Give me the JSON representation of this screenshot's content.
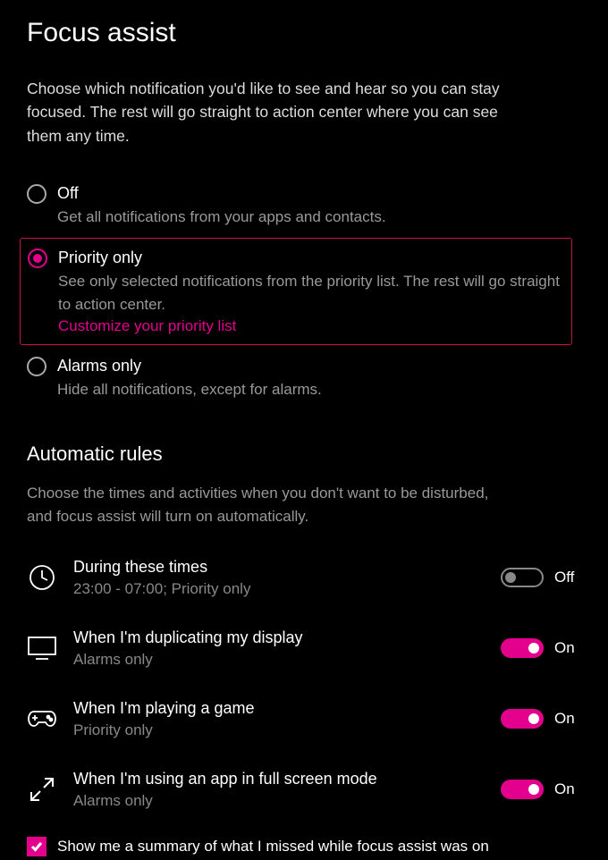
{
  "title": "Focus assist",
  "description": "Choose which notification you'd like to see and hear so you can stay focused. The rest will go straight to action center where you can see them any time.",
  "radios": {
    "off": {
      "label": "Off",
      "subtext": "Get all notifications from your apps and contacts."
    },
    "priority": {
      "label": "Priority only",
      "subtext": "See only selected notifications from the priority list. The rest will go straight to action center.",
      "link": "Customize your priority list"
    },
    "alarms": {
      "label": "Alarms only",
      "subtext": "Hide all notifications, except for alarms."
    }
  },
  "rulesSection": {
    "heading": "Automatic rules",
    "description": "Choose the times and activities when you don't want to be disturbed, and focus assist will turn on automatically."
  },
  "rules": [
    {
      "label": "During these times",
      "sub": "23:00 - 07:00; Priority only",
      "on": false,
      "state": "Off"
    },
    {
      "label": "When I'm duplicating my display",
      "sub": "Alarms only",
      "on": true,
      "state": "On"
    },
    {
      "label": "When I'm playing a game",
      "sub": "Priority only",
      "on": true,
      "state": "On"
    },
    {
      "label": "When I'm using an app in full screen mode",
      "sub": "Alarms only",
      "on": true,
      "state": "On"
    }
  ],
  "summaryCheckbox": {
    "checked": true,
    "label": "Show me a summary of what I missed while focus assist was on"
  }
}
